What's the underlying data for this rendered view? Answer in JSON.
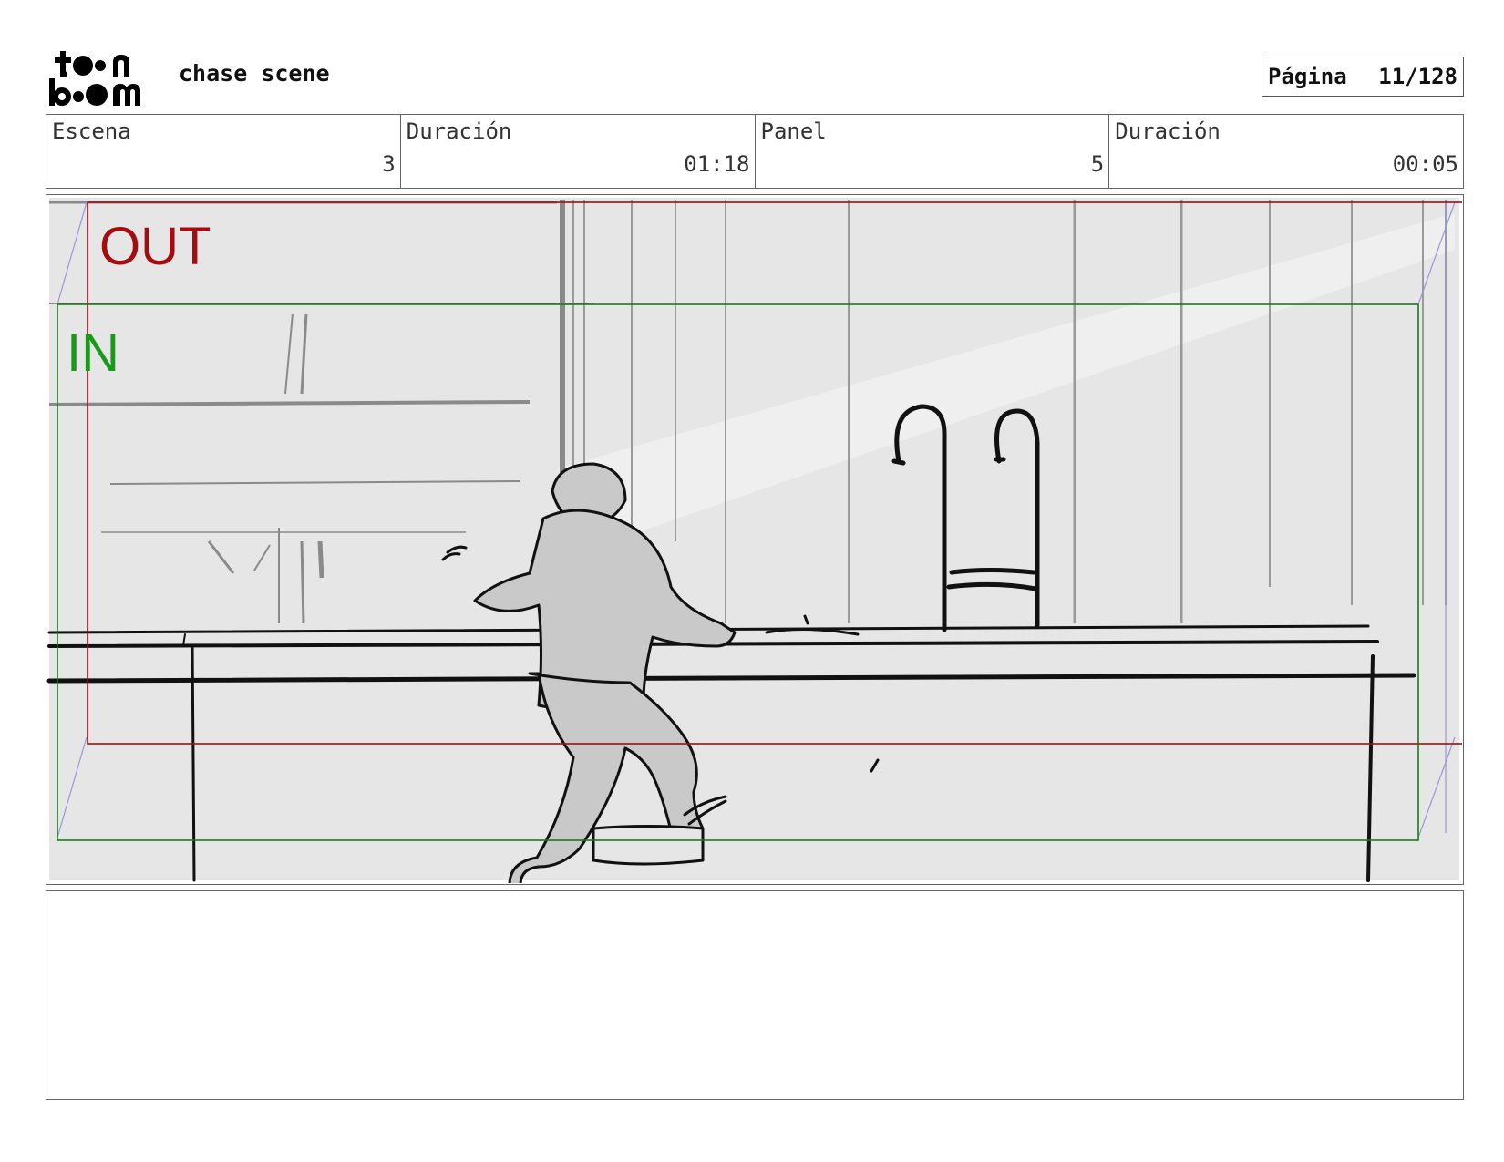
{
  "header": {
    "project_title": "chase scene",
    "page_label": "Página",
    "page_number": "11/128"
  },
  "info": {
    "scene_label": "Escena",
    "scene_value": "3",
    "scene_duration_label": "Duración",
    "scene_duration_value": "01:18",
    "panel_label": "Panel",
    "panel_value": "5",
    "panel_duration_label": "Duración",
    "panel_duration_value": "00:05"
  },
  "panel": {
    "out_label": "OUT",
    "in_label": "IN",
    "out_color": "#a30d12",
    "in_color": "#1a9a1a",
    "background_color": "#e6e6e6"
  },
  "notes": {
    "text": ""
  }
}
